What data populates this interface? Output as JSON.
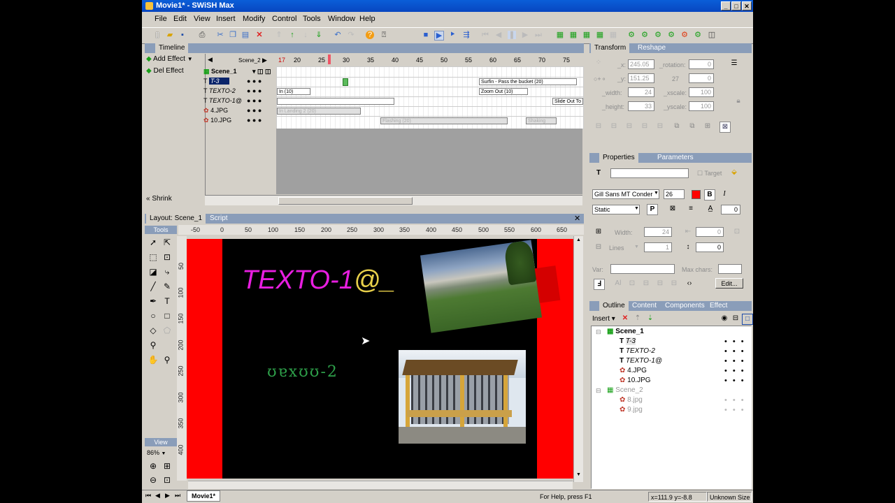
{
  "window": {
    "title": "Movie1* - SWiSH Max"
  },
  "menu": [
    "File",
    "Edit",
    "View",
    "Insert",
    "Modify",
    "Control",
    "Tools",
    "Window",
    "Help"
  ],
  "timeline": {
    "tab": "Timeline",
    "add_effect": "Add Effect",
    "del_effect": "Del Effect",
    "shrink": "Shrink",
    "scene_select": "Scene_2",
    "ruler_ticks": [
      "17",
      "20",
      "25",
      "30",
      "35",
      "40",
      "45",
      "50",
      "55",
      "60",
      "65",
      "70",
      "75"
    ],
    "layers": [
      {
        "name": "Scene_1",
        "type": "scene"
      },
      {
        "name": "T-3",
        "type": "text"
      },
      {
        "name": "TEXTO-2",
        "type": "text"
      },
      {
        "name": "TEXTO-1@",
        "type": "text"
      },
      {
        "name": "4.JPG",
        "type": "image"
      },
      {
        "name": "10.JPG",
        "type": "image"
      }
    ],
    "effects": {
      "surfin": "Surfin - Pass the bucket (20)",
      "zoom_out": "Zoom Out (10)",
      "in": "In (10)",
      "slide_out": "Slide Out To",
      "landing": "In Landing 2 (20)",
      "flashing": "Flashing (20)",
      "shaking": "Shaking"
    }
  },
  "layout": {
    "tab_layout": "Layout: Scene_1",
    "tab_script": "Script",
    "ruler_h": [
      "-50",
      "0",
      "50",
      "100",
      "150",
      "200",
      "250",
      "300",
      "350",
      "400",
      "450",
      "500",
      "550",
      "600",
      "650"
    ],
    "ruler_v": [
      "50",
      "100",
      "150",
      "200",
      "250",
      "300",
      "350",
      "400"
    ],
    "tools_label": "Tools",
    "view_label": "View",
    "zoom": "86%",
    "scene_tab": "Movie1*",
    "stage_text1": "TEXTO-1",
    "stage_text1_suffix": "@_",
    "stage_text2": "ʊɐxʊʊ-2"
  },
  "transform": {
    "tab_transform": "Transform",
    "tab_reshape": "Reshape",
    "x_label": "_x:",
    "x_value": "245.05",
    "y_label": "_y:",
    "y_value": "151.25",
    "rotation_label": "_rotation:",
    "rotation_value": "0",
    "skew_label": "27",
    "skew_value": "0",
    "width_label": "_width:",
    "width_value": "24",
    "height_label": "_height:",
    "height_value": "33",
    "xscale_label": "_xscale:",
    "xscale_value": "100",
    "yscale_label": "_yscale:",
    "yscale_value": "100"
  },
  "properties": {
    "tab_properties": "Properties",
    "tab_parameters": "Parameters",
    "target_label": "Target",
    "font": "Gill Sans MT Conder",
    "size": "26",
    "text_type": "Static",
    "spacing": "0",
    "width_label": "Width:",
    "width_value": "24",
    "width_spin": "0",
    "lines_label": "Lines",
    "lines_value": "1",
    "line_spacing": "0",
    "var_label": "Var:",
    "maxchars_label": "Max chars:",
    "edit_button": "Edit...",
    "text_color": "#ff0000"
  },
  "outline": {
    "tab_outline": "Outline",
    "tab_content": "Content",
    "tab_components": "Components",
    "tab_effect": "Effect",
    "insert": "Insert",
    "tree": [
      {
        "label": "Scene_1",
        "level": 0,
        "kind": "scene",
        "dim": false
      },
      {
        "label": "T-3",
        "level": 1,
        "kind": "text",
        "dim": false
      },
      {
        "label": "TEXTO-2",
        "level": 1,
        "kind": "text",
        "dim": false
      },
      {
        "label": "TEXTO-1@",
        "level": 1,
        "kind": "text",
        "dim": false
      },
      {
        "label": "4.JPG",
        "level": 1,
        "kind": "image",
        "dim": false
      },
      {
        "label": "10.JPG",
        "level": 1,
        "kind": "image",
        "dim": false
      },
      {
        "label": "Scene_2",
        "level": 0,
        "kind": "scene",
        "dim": true
      },
      {
        "label": "8.jpg",
        "level": 1,
        "kind": "image",
        "dim": true
      },
      {
        "label": "9.jpg",
        "level": 1,
        "kind": "image",
        "dim": true
      }
    ]
  },
  "status": {
    "help": "For Help, press F1",
    "coords": "x=111.9 y=-8.8",
    "size": "Unknown Size"
  }
}
